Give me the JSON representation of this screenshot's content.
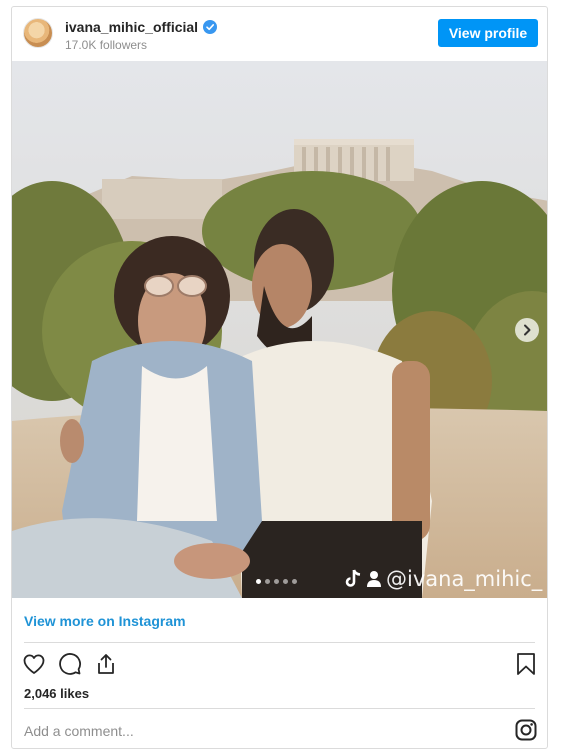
{
  "header": {
    "username": "ivana_mihic_official",
    "followers": "17.0K followers",
    "view_profile_label": "View profile"
  },
  "post": {
    "watermark_text": "@ivana_mihic_",
    "carousel": {
      "total": 5,
      "active": 0
    }
  },
  "footer": {
    "view_more_label": "View more on Instagram",
    "likes": "2,046 likes",
    "comment_placeholder": "Add a comment..."
  },
  "icons": [
    "verified-badge-icon",
    "chevron-right-icon",
    "tiktok-icon",
    "user-icon",
    "heart-icon",
    "comment-icon",
    "share-icon",
    "bookmark-icon",
    "instagram-icon"
  ],
  "colors": {
    "accent": "#0095f6",
    "link": "#1f93d6",
    "text": "#262626",
    "muted": "#8e8e8e",
    "border": "#dbdbdb"
  }
}
